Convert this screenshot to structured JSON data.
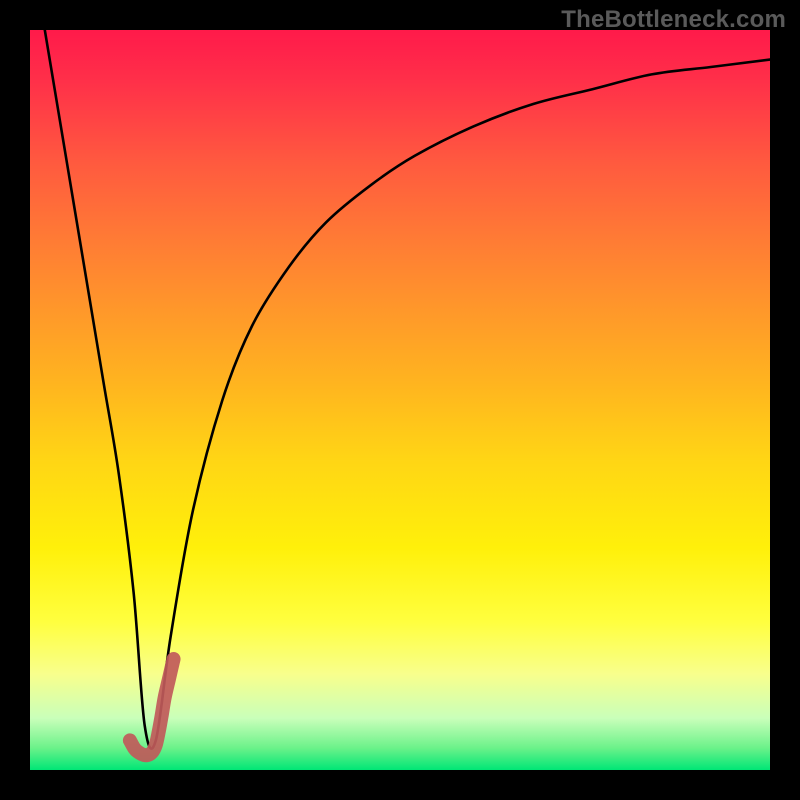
{
  "watermark": "TheBottleneck.com",
  "chart_data": {
    "type": "line",
    "title": "",
    "xlabel": "",
    "ylabel": "",
    "xlim": [
      0,
      100
    ],
    "ylim": [
      0,
      100
    ],
    "grid": false,
    "legend": false,
    "series": [
      {
        "name": "bottleneck-curve",
        "color": "#000000",
        "x": [
          2,
          4,
          6,
          8,
          10,
          12,
          14,
          15.5,
          17,
          19,
          22,
          26,
          30,
          35,
          40,
          46,
          52,
          60,
          68,
          76,
          84,
          92,
          100
        ],
        "y": [
          100,
          88,
          76,
          64,
          52,
          40,
          24,
          6,
          4,
          18,
          35,
          50,
          60,
          68,
          74,
          79,
          83,
          87,
          90,
          92,
          94,
          95,
          96
        ]
      },
      {
        "name": "optimal-marker",
        "color": "#c05a5a",
        "x": [
          13.5,
          14.2,
          15.0,
          15.8,
          16.5,
          17.0,
          17.4,
          17.8,
          18.2,
          18.8,
          19.4
        ],
        "y": [
          4.0,
          2.8,
          2.2,
          2.0,
          2.4,
          3.4,
          5.2,
          7.4,
          9.8,
          12.4,
          15.0
        ]
      }
    ]
  }
}
